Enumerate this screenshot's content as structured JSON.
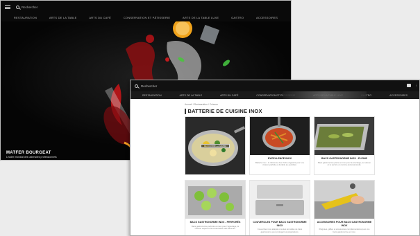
{
  "back_window": {
    "search_placeholder": "Rechercher",
    "nav": [
      "RESTAURATION",
      "ARTS DE LA TABLE",
      "ARTS DU CAFÉ",
      "CONSERVATION ET PÂTISSERIE",
      "ARTS DE LA TABLE LUXE",
      "GASTRO",
      "ACCESSOIRES"
    ],
    "hero_title": "MATFER BOURGEAT",
    "hero_subtitle": "Leader mondial des ustensiles professionnels"
  },
  "front_window": {
    "search_placeholder": "Rechercher",
    "nav": [
      "RESTAURATION",
      "ARTS DE LA TABLE",
      "ARTS DU CAFÉ",
      "CONSERVATION ET PÂTISSERIE",
      "ARTS DE LA TABLE LUXE",
      "GASTRO",
      "ACCESSOIRES"
    ],
    "breadcrumb": "Accueil / Restauration / Cuisson",
    "page_title": "BATTERIE DE CUISINE INOX",
    "cards": [
      {
        "label": "",
        "desc": "",
        "cta": "DÉCOUVRIR LA GAMME"
      },
      {
        "label": "EXCELLENCE INOX",
        "desc": "Batterie inox - la référence des chefs exigeants pour une cuisson parfaite et durable au quotidien.",
        "cta": ""
      },
      {
        "label": "BACS GASTRONORME INOX - PLEINS",
        "desc": "Bacs gastronorme pleins en inox pour le stockage, la cuisson et le service en cuisine professionnelle.",
        "cta": ""
      },
      {
        "label": "BACS GASTRONORME INOX - PERFORÉS",
        "desc": "Bacs gastronorme perforés en inox pour l'égouttage, la cuisson vapeur et la conservation des aliments.",
        "cta": ""
      },
      {
        "label": "COUVERCLES POUR BACS GASTRONORME INOX",
        "desc": "Couvercles inox adaptés à toutes les tailles de bacs gastronorme pour protéger les préparations.",
        "cta": ""
      },
      {
        "label": "ACCESSOIRES POUR BACS GASTRONORME INOX",
        "desc": "Poignées, grilles et accessoires complémentaires pour vos bacs gastronorme en inox.",
        "cta": ""
      }
    ]
  }
}
